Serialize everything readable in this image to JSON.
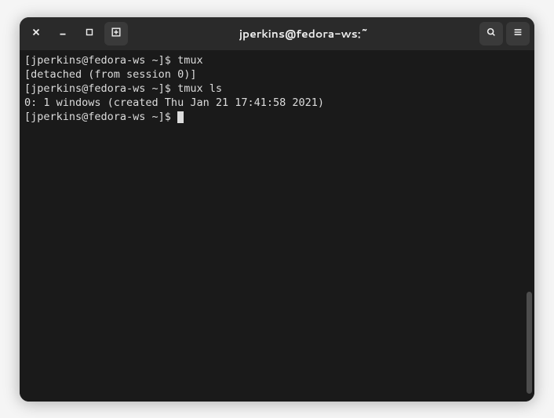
{
  "titlebar": {
    "title": "jperkins@fedora-ws:~"
  },
  "terminal": {
    "lines": [
      {
        "prompt": "[jperkins@fedora-ws ~]$ ",
        "cmd": "tmux"
      },
      {
        "output": "[detached (from session 0)]"
      },
      {
        "prompt": "[jperkins@fedora-ws ~]$ ",
        "cmd": "tmux ls"
      },
      {
        "output": "0: 1 windows (created Thu Jan 21 17:41:58 2021)"
      },
      {
        "prompt": "[jperkins@fedora-ws ~]$ ",
        "cmd": "",
        "cursor": true
      }
    ]
  },
  "icons": {
    "close": "close-icon",
    "minimize": "minimize-icon",
    "maximize": "maximize-icon",
    "newtab": "new-tab-icon",
    "search": "search-icon",
    "menu": "menu-icon"
  }
}
